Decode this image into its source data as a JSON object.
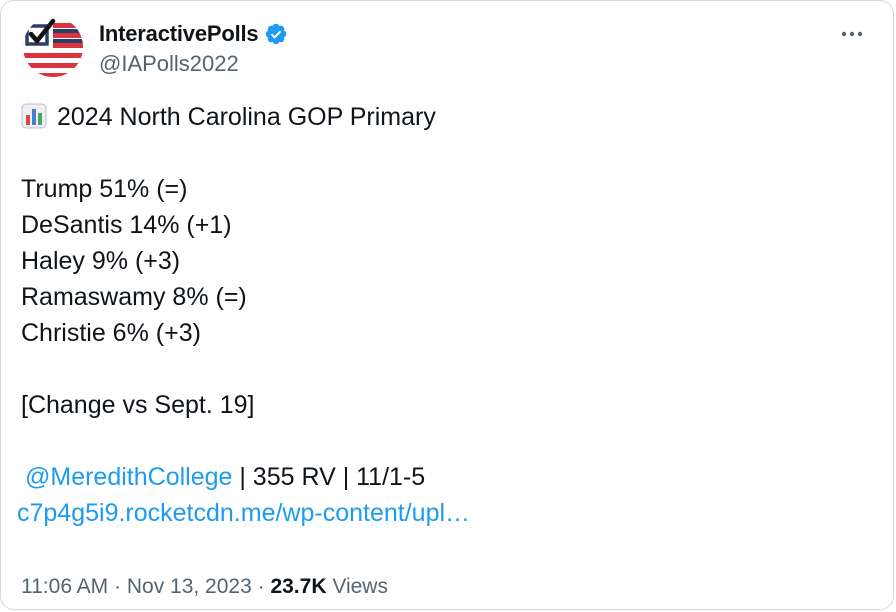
{
  "author": {
    "display_name": "InteractivePolls",
    "handle": "@IAPolls2022",
    "avatar_icon": "us-flag-checkmark-icon",
    "verified_icon": "verified-badge-icon",
    "verified_color": "#1d9bf0"
  },
  "more_icon": "more-options-icon",
  "post": {
    "chart_emoji": "bar-chart-emoji-icon",
    "title": "2024 North Carolina GOP Primary",
    "results": [
      "Trump 51% (=)",
      "DeSantis 14% (+1)",
      "Haley 9% (+3)",
      "Ramaswamy 8% (=)",
      "Christie 6% (+3)"
    ],
    "note": "[Change vs Sept. 19]",
    "mention": "@MeredithCollege",
    "source_details": " | 355 RV | 11/1-5",
    "url": "c7p4g5i9.rocketcdn.me/wp-content/upl…"
  },
  "meta": {
    "time": "11:06 AM",
    "separator1": " · ",
    "date": "Nov 13, 2023",
    "separator2": " · ",
    "views_count": "23.7K",
    "views_label": " Views"
  },
  "colors": {
    "link": "#1d9bf0",
    "secondary_text": "#536471",
    "primary_text": "#0f1419",
    "border": "#cfd9de"
  }
}
